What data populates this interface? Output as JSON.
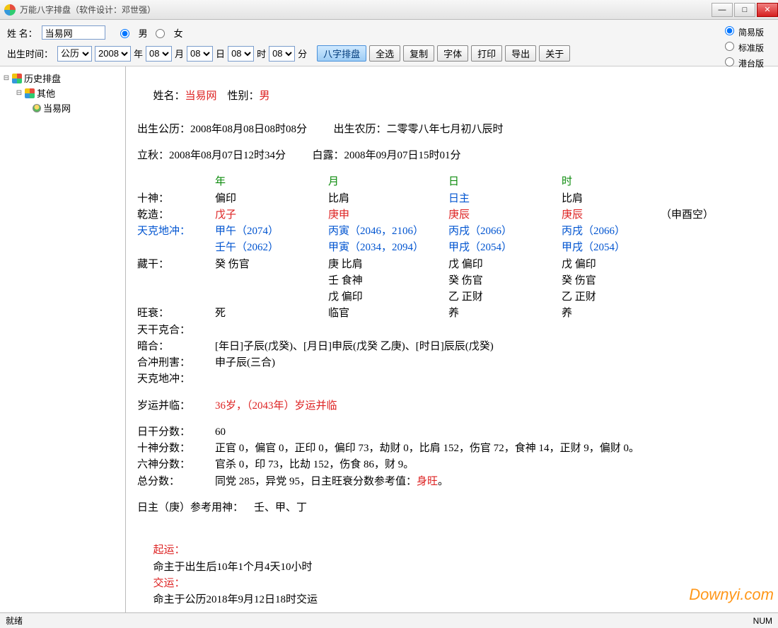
{
  "window": {
    "title": "万能八字排盘（软件设计：邓世强）",
    "minimize": "—",
    "maximize": "□",
    "close": "✕"
  },
  "toolbar": {
    "name_label": "姓      名：",
    "name_value": "当易网",
    "gender_male": "男",
    "gender_female": "女",
    "birth_label": "出生时间：",
    "calendar": "公历",
    "year": "2008",
    "year_suffix": "年",
    "month": "08",
    "month_suffix": "月",
    "day": "08",
    "day_suffix": "日",
    "hour": "08",
    "hour_suffix": "时",
    "minute": "08",
    "minute_suffix": "分",
    "btn_paipan": "八字排盘",
    "btn_selectall": "全选",
    "btn_copy": "复制",
    "btn_font": "字体",
    "btn_print": "打印",
    "btn_export": "导出",
    "btn_about": "关于",
    "ver_simple": "简易版",
    "ver_standard": "标准版",
    "ver_gangtai": "港台版"
  },
  "tree": {
    "root": "历史排盘",
    "group": "其他",
    "leaf": "当易网"
  },
  "result": {
    "line1_a": "姓名：",
    "line1_name": "当易网",
    "line1_b": "    性别：",
    "line1_gender": "男",
    "line2": "出生公历：2008年08月08日08时08分          出生农历：二零零八年七月初八辰时",
    "line3": "立秋：2008年08月07日12时34分          白露：2008年09月07日15时01分",
    "header_cols": {
      "c0": "",
      "c1": "年",
      "c2": "月",
      "c3": "日",
      "c4": "时",
      "c5": ""
    },
    "shishen": {
      "label": "十神：",
      "c1": "偏印",
      "c2": "比肩",
      "c3": "日主",
      "c4": "比肩"
    },
    "qianzao": {
      "label": "乾造：",
      "c1": "戊子",
      "c2": "庚申",
      "c3": "庚辰",
      "c4": "庚辰",
      "extra": "（申酉空）"
    },
    "tkdc1": {
      "label": "天克地冲：",
      "c1": "甲午（2074）",
      "c2": "丙寅（2046，2106）",
      "c3": "丙戌（2066）",
      "c4": "丙戌（2066）"
    },
    "tkdc2": {
      "label": "",
      "c1": "壬午（2062）",
      "c2": "甲寅（2034，2094）",
      "c3": "甲戌（2054）",
      "c4": "甲戌（2054）"
    },
    "canggan1": {
      "label": "藏干：",
      "c1": "癸    伤官",
      "c2": "庚    比肩",
      "c3": "戊    偏印",
      "c4": "戊    偏印"
    },
    "canggan2": {
      "label": "",
      "c1": "",
      "c2": "壬    食神",
      "c3": "癸    伤官",
      "c4": "癸    伤官"
    },
    "canggan3": {
      "label": "",
      "c1": "",
      "c2": "戊    偏印",
      "c3": "乙    正财",
      "c4": "乙    正财"
    },
    "wangshuai": {
      "label": "旺衰：",
      "c1": "死",
      "c2": "临官",
      "c3": "养",
      "c4": "养"
    },
    "tgkh": "天干克合：",
    "anhe_label": "暗合：",
    "anhe_val": "[年日]子辰(戊癸)、[月日]申辰(戊癸 乙庚)、[时日]辰辰(戊癸)",
    "hcxh_label": "合冲刑害：",
    "hcxh_val": "申子辰(三合)",
    "tkdc_label": "天克地冲：",
    "suiyun_label": "岁运并临：",
    "suiyun_val": "36岁，（2043年）岁运并临",
    "rgfs_label": "日干分数：",
    "rgfs_val": "60",
    "ssfs_label": "十神分数：",
    "ssfs_val": "正官 0，偏官 0，正印 0，偏印 73，劫财 0，比肩 152，伤官 72，食神 14，正财 9，偏财 0。",
    "lsfs_label": "六神分数：",
    "lsfs_val": "官杀 0，印 73，比劫 152，伤食 86，财 9。",
    "zfs_label": "总分数：",
    "zfs_a": "同党 285，异党 95，日主旺衰分数参考值：",
    "zfs_b": "身旺",
    "zfs_c": "。",
    "yongshen": "日主（庚）参考用神：    壬、甲、丁",
    "qiyun_label": "起运：",
    "qiyun_val": "命主于出生后10年1个月4天10小时",
    "jiaoyun_label": "交运：",
    "jiaoyun_val": "命主于公历2018年9月12日18时交运"
  },
  "status": {
    "left": "就绪",
    "right": "NUM"
  },
  "watermark": "Downyi.com"
}
